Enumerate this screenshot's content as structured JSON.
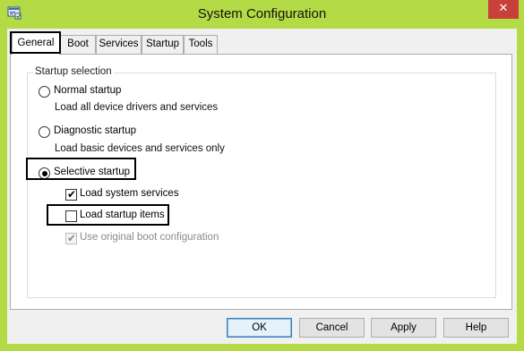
{
  "window": {
    "title": "System Configuration",
    "close_glyph": "✕"
  },
  "tabs": [
    "General",
    "Boot",
    "Services",
    "Startup",
    "Tools"
  ],
  "active_tab": "General",
  "startup_selection": {
    "group_label": "Startup selection",
    "options": [
      {
        "label": "Normal startup",
        "description": "Load all device drivers and services",
        "selected": false
      },
      {
        "label": "Diagnostic startup",
        "description": "Load basic devices and services only",
        "selected": false
      },
      {
        "label": "Selective startup",
        "selected": true
      }
    ],
    "selective_items": [
      {
        "label": "Load system services",
        "checked": true,
        "enabled": true
      },
      {
        "label": "Load startup items",
        "checked": false,
        "enabled": true
      },
      {
        "label": "Use original boot configuration",
        "checked": true,
        "enabled": false
      }
    ]
  },
  "buttons": {
    "ok": "OK",
    "cancel": "Cancel",
    "apply": "Apply",
    "help": "Help"
  },
  "colors": {
    "frame": "#b4da46",
    "close_button": "#c7413a",
    "client": "#f0f0f0"
  },
  "icons": {
    "app": "msconfig-window-icon",
    "check": "✔"
  }
}
